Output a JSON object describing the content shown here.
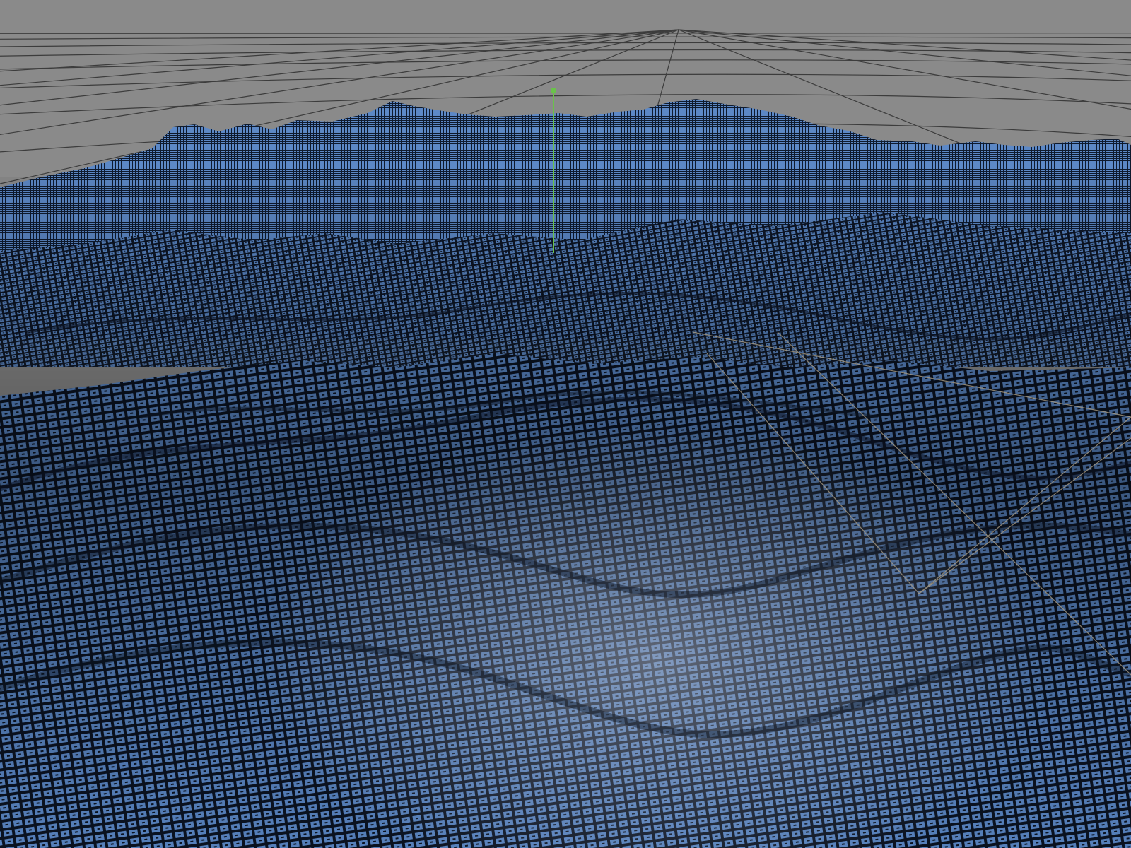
{
  "viewport": {
    "view": "perspective",
    "shading": "wireframe",
    "object_type": "terrain-mesh",
    "grid_visible": true,
    "axis_gizmo_visible": true,
    "colors": {
      "background": "#8a8a8a",
      "floor_grid": "#3c3c3c",
      "mesh_wire": "#5a86c4",
      "mesh_dark": "#0b1322",
      "mesh_light": "#b2c4e0",
      "axis_y": "#6ac24a",
      "bounding_lines": "#a89a80"
    }
  }
}
